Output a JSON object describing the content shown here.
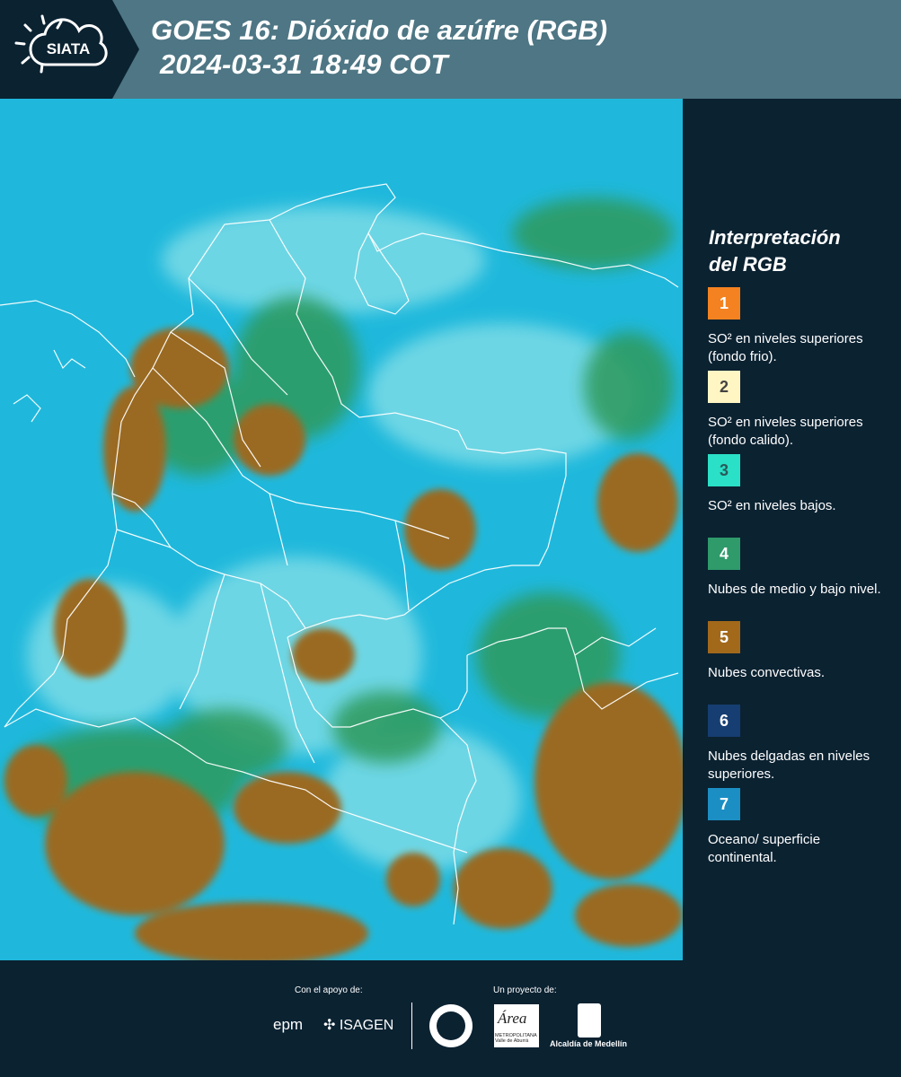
{
  "header": {
    "logo_text": "SIATA",
    "title_line1": "GOES 16: Dióxido de azúfre (RGB)",
    "title_line2": "2024-03-31 18:49 COT",
    "background_color": "#4e7684"
  },
  "map": {
    "ocean_color": "#1fb8dc",
    "cloud_color": "#9a6a24",
    "vegetation_color": "#2f9a5c",
    "border_color": "#ffffff"
  },
  "legend": {
    "title_line1": "Interpretación",
    "title_line2": "del RGB",
    "items": [
      {
        "number": "1",
        "color": "#f58220",
        "number_color": "#ffffff",
        "text": "SO² en niveles superiores (fondo frio)."
      },
      {
        "number": "2",
        "color": "#fff6c3",
        "number_color": "#444444",
        "text": "SO² en niveles superiores (fondo calido)."
      },
      {
        "number": "3",
        "color": "#2ae0c6",
        "number_color": "#2a5a5a",
        "text": "SO² en niveles bajos."
      },
      {
        "number": "4",
        "color": "#2f9a6a",
        "number_color": "#ffffff",
        "text": "Nubes de medio y bajo nivel."
      },
      {
        "number": "5",
        "color": "#a2691b",
        "number_color": "#ffffff",
        "text": "Nubes convectivas."
      },
      {
        "number": "6",
        "color": "#163e72",
        "number_color": "#ffffff",
        "text": "Nubes delgadas en niveles superiores."
      },
      {
        "number": "7",
        "color": "#1b8fc4",
        "number_color": "#ffffff",
        "text": "Oceano/ superficie continental."
      }
    ]
  },
  "footer": {
    "support_label": "Con el apoyo de:",
    "project_label": "Un proyecto de:",
    "sponsor1": "epm",
    "sponsor2": "ISAGEN",
    "area_title": "Área",
    "area_sub1": "METROPOLITANA",
    "area_sub2": "Valle de Aburrá",
    "alcaldia": "Alcaldía de Medellín"
  }
}
